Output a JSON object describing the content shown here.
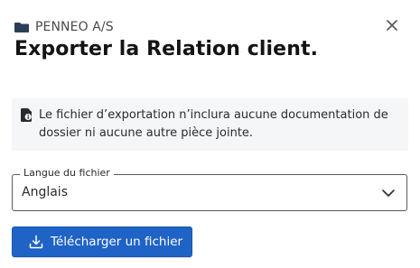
{
  "dialog": {
    "organization": "PENNEO A/S",
    "title": "Exporter la Relation client.",
    "notice": "Le fichier d’exportation n’inclura aucune documentation de dossier ni aucune autre pièce jointe.",
    "language_field": {
      "label": "Langue du fichier",
      "value": "Anglais"
    },
    "download_button_label": "Télécharger un fichier"
  },
  "icons": {
    "organization": "folder-icon",
    "close": "close-icon",
    "notice": "file-info-icon",
    "select": "chevron-down-icon",
    "download": "download-icon"
  },
  "colors": {
    "primary_button": "#1f63c6",
    "notice_background": "#f5f6f8"
  }
}
